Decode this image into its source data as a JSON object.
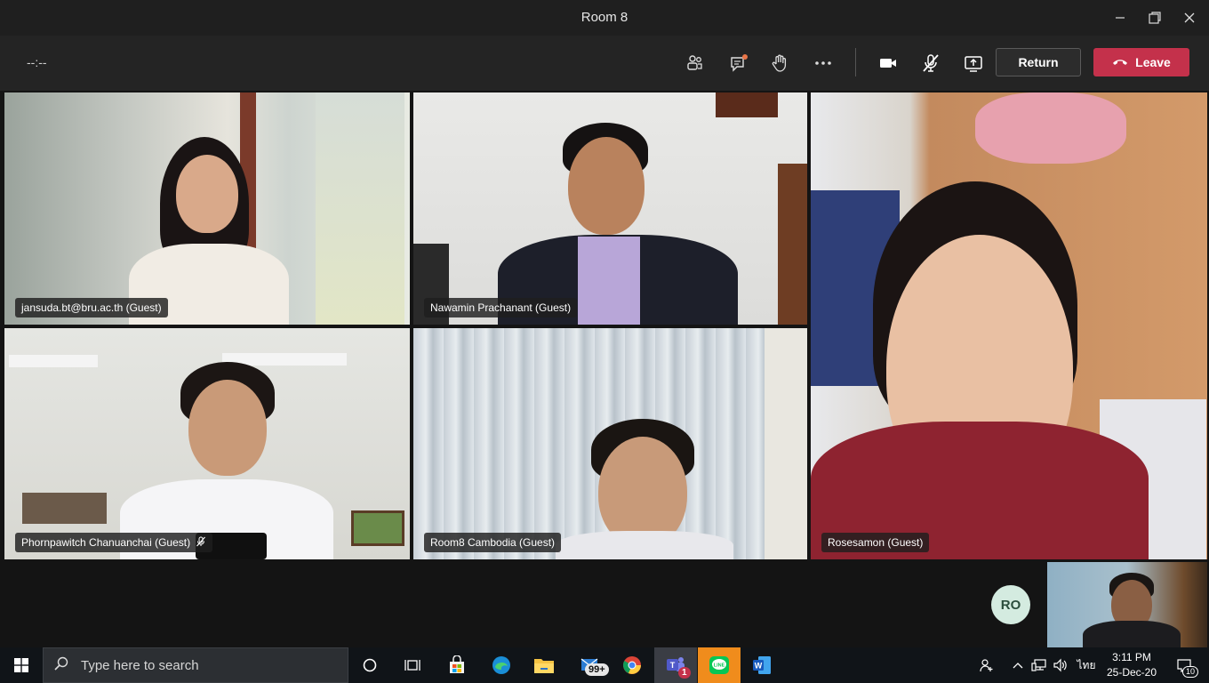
{
  "window": {
    "title": "Room 8"
  },
  "toolbar": {
    "timer": "--:--",
    "return_label": "Return",
    "leave_label": "Leave"
  },
  "participants": [
    {
      "name": "jansuda.bt@bru.ac.th (Guest)",
      "muted": false
    },
    {
      "name": "Nawamin Prachanant (Guest)",
      "muted": false
    },
    {
      "name": "Rosesamon (Guest)",
      "muted": false
    },
    {
      "name": "Phornpawitch Chanuanchai (Guest)",
      "muted": true
    },
    {
      "name": "Room8 Cambodia (Guest)",
      "muted": false
    }
  ],
  "overflow_avatar": {
    "initials": "RO"
  },
  "taskbar": {
    "search_placeholder": "Type here to search",
    "store_badge": "99+",
    "teams_badge": "1",
    "language": "ไทย",
    "time": "3:11 PM",
    "date": "25-Dec-20",
    "notification_count": "10"
  },
  "colors": {
    "leave": "#c4314b",
    "background": "#1f1f1f",
    "avatar_bg": "#d4ebe0"
  }
}
